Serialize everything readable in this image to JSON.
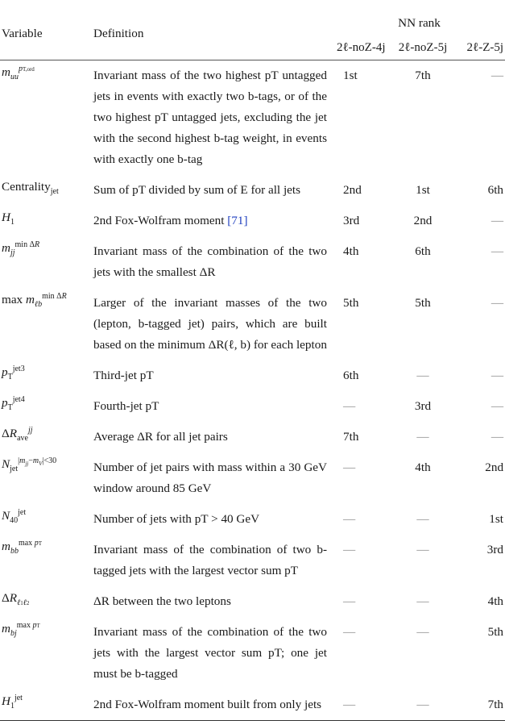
{
  "table": {
    "headers": {
      "variable": "Variable",
      "definition": "Definition",
      "group": "NN rank",
      "regions": [
        "2ℓ-noZ-4j",
        "2ℓ-noZ-5j",
        "2ℓ-Z-5j"
      ]
    },
    "rows": [
      {
        "variable": "m_uu^{pT,ord}",
        "definition": "Invariant mass of the two highest pT untagged jets in events with exactly two b-tags, or of the two highest pT untagged jets, excluding the jet with the second highest b-tag weight, in events with exactly one b-tag",
        "ranks": [
          "1st",
          "7th",
          "—"
        ]
      },
      {
        "variable": "Centrality_jet",
        "definition": "Sum of pT divided by sum of E for all jets",
        "ranks": [
          "2nd",
          "1st",
          "6th"
        ]
      },
      {
        "variable": "H_1",
        "definition": "2nd Fox-Wolfram moment",
        "citation": "[71]",
        "ranks": [
          "3rd",
          "2nd",
          "—"
        ]
      },
      {
        "variable": "m_jj^{min ΔR}",
        "definition": "Invariant mass of the combination of the two jets with the smallest ΔR",
        "ranks": [
          "4th",
          "6th",
          "—"
        ]
      },
      {
        "variable": "max m_ℓb^{min ΔR}",
        "definition": "Larger of the invariant masses of the two (lepton, b-tagged jet) pairs, which are built based on the minimum ΔR(ℓ, b) for each lepton",
        "ranks": [
          "5th",
          "5th",
          "—"
        ]
      },
      {
        "variable": "pT^{jet3}",
        "definition": "Third-jet pT",
        "ranks": [
          "6th",
          "—",
          "—"
        ]
      },
      {
        "variable": "pT^{jet4}",
        "definition": "Fourth-jet pT",
        "ranks": [
          "—",
          "3rd",
          "—"
        ]
      },
      {
        "variable": "ΔR_ave^{jj}",
        "definition": "Average ΔR for all jet pairs",
        "ranks": [
          "7th",
          "—",
          "—"
        ]
      },
      {
        "variable": "N_jet^{|m_jj − m_V|<30}",
        "definition": "Number of jet pairs with mass within a 30 GeV window around 85 GeV",
        "ranks": [
          "—",
          "4th",
          "2nd"
        ]
      },
      {
        "variable": "N_40^{jet}",
        "definition": "Number of jets with pT > 40 GeV",
        "ranks": [
          "—",
          "—",
          "1st"
        ]
      },
      {
        "variable": "m_bb^{max pT}",
        "definition": "Invariant mass of the combination of two b-tagged jets with the largest vector sum pT",
        "ranks": [
          "—",
          "—",
          "3rd"
        ]
      },
      {
        "variable": "ΔR_{ℓ1ℓ2}",
        "definition": "ΔR between the two leptons",
        "ranks": [
          "—",
          "—",
          "4th"
        ]
      },
      {
        "variable": "m_bj^{max pT}",
        "definition": "Invariant mass of the combination of the two jets with the largest vector sum pT; one jet must be b-tagged",
        "ranks": [
          "—",
          "—",
          "5th"
        ]
      },
      {
        "variable": "H_1^{jet}",
        "definition": "2nd Fox-Wolfram moment built from only jets",
        "ranks": [
          "—",
          "—",
          "7th"
        ]
      }
    ]
  },
  "colors": {
    "text": "#1a1a1a",
    "citation_link": "#1f3fbf",
    "dash": "#8a8a8a"
  }
}
